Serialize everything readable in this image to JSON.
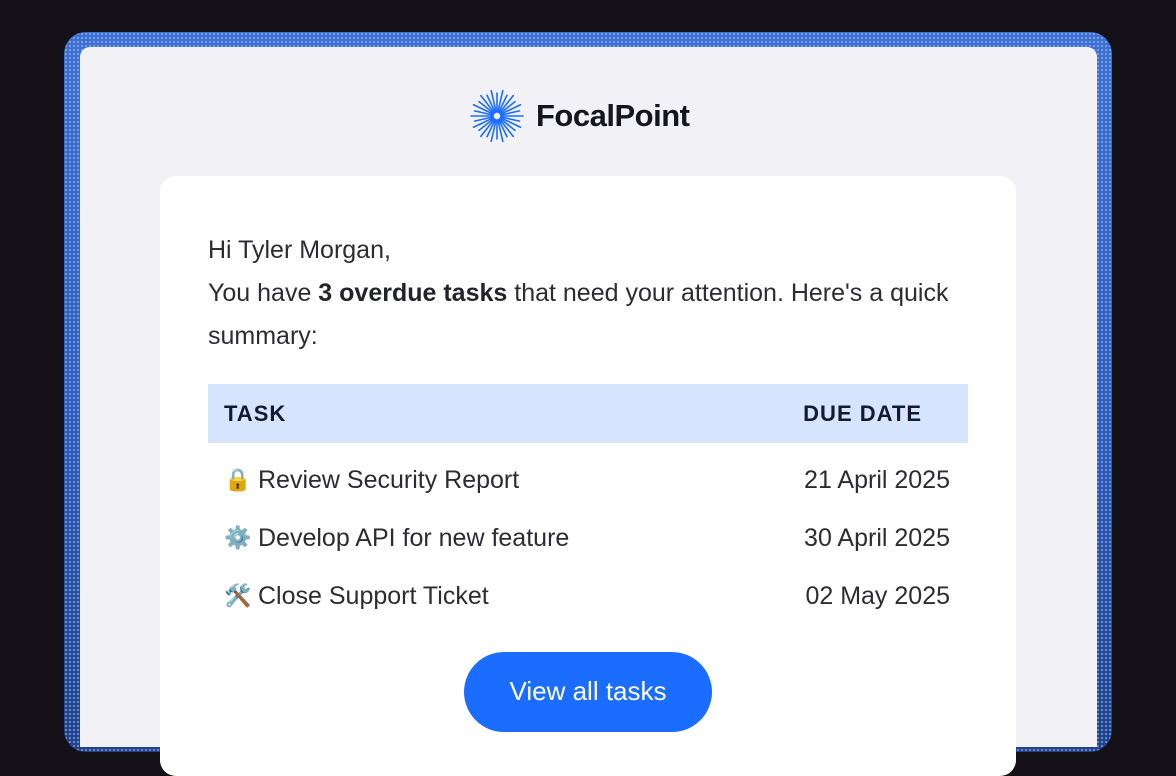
{
  "brand": {
    "name": "FocalPoint",
    "logo_icon": "starburst-icon",
    "accent": "#1a6dff"
  },
  "email": {
    "greeting": "Hi Tyler Morgan,",
    "message_prefix": "You have ",
    "message_bold": "3 overdue tasks",
    "message_suffix": " that need your attention. Here's a quick summary:"
  },
  "table": {
    "headers": {
      "task": "TASK",
      "due": "DUE DATE"
    },
    "rows": [
      {
        "icon": "🔒",
        "icon_name": "lock-icon",
        "task": "Review Security Report",
        "due": "21 April 2025"
      },
      {
        "icon": "⚙️",
        "icon_name": "gear-icon",
        "task": "Develop API for new feature",
        "due": "30 April 2025"
      },
      {
        "icon": "🛠️",
        "icon_name": "tools-icon",
        "task": "Close Support Ticket",
        "due": "02 May 2025"
      }
    ]
  },
  "cta": {
    "label": "View all tasks"
  },
  "colors": {
    "header_bg": "#d6e4fd",
    "page_bg": "#f1f1f6",
    "frame": "#2f5fbd",
    "button": "#1a6dff"
  }
}
